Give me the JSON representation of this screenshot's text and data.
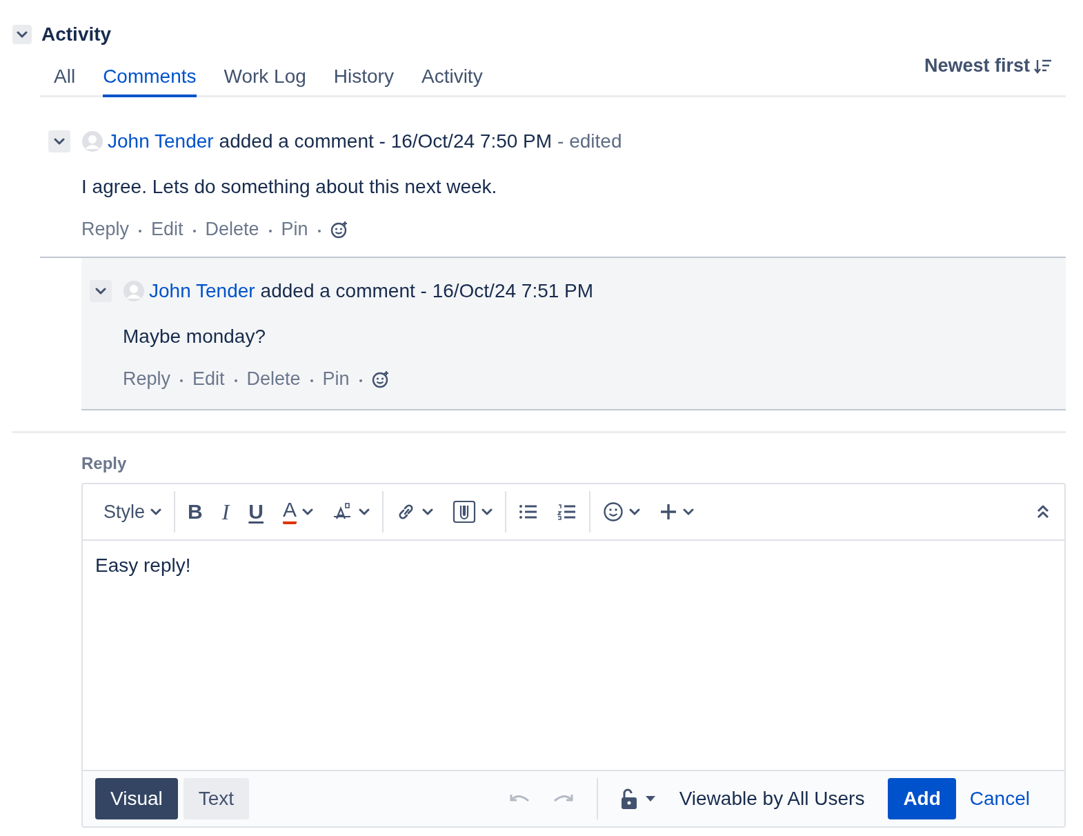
{
  "section": {
    "title": "Activity",
    "expanded": true
  },
  "tabs": [
    {
      "label": "All",
      "selected": false
    },
    {
      "label": "Comments",
      "selected": true
    },
    {
      "label": "Work Log",
      "selected": false
    },
    {
      "label": "History",
      "selected": false
    },
    {
      "label": "Activity",
      "selected": false
    }
  ],
  "sort": {
    "label": "Newest first"
  },
  "comments": [
    {
      "author": "John Tender",
      "action": "added a comment - 16/Oct/24 7:50 PM",
      "edited": "- edited",
      "body": "I agree. Lets do something about this next week.",
      "actions": [
        "Reply",
        "Edit",
        "Delete",
        "Pin"
      ],
      "expanded": true,
      "nested": false
    },
    {
      "author": "John Tender",
      "action": "added a comment - 16/Oct/24 7:51 PM",
      "body": "Maybe monday?",
      "actions": [
        "Reply",
        "Edit",
        "Delete",
        "Pin"
      ],
      "expanded": true,
      "nested": true
    }
  ],
  "reply": {
    "label": "Reply",
    "toolbar": [
      {
        "kind": "style",
        "text": "Style"
      },
      {
        "kind": "sep"
      },
      {
        "kind": "bold",
        "text": "B"
      },
      {
        "kind": "italic",
        "text": "I"
      },
      {
        "kind": "underline",
        "text": "U"
      },
      {
        "kind": "color",
        "text": "A"
      },
      {
        "kind": "format"
      },
      {
        "kind": "sep"
      },
      {
        "kind": "link"
      },
      {
        "kind": "attach"
      },
      {
        "kind": "sep"
      },
      {
        "kind": "bullets"
      },
      {
        "kind": "numbers"
      },
      {
        "kind": "sep"
      },
      {
        "kind": "emoji"
      },
      {
        "kind": "plus"
      }
    ],
    "value": "Easy reply!",
    "modes": [
      {
        "label": "Visual",
        "selected": true
      },
      {
        "label": "Text",
        "selected": false
      }
    ],
    "visibility": "Viewable by All Users",
    "buttons": [
      {
        "label": "Add",
        "kind": "primary"
      },
      {
        "label": "Cancel",
        "kind": "link"
      }
    ]
  }
}
